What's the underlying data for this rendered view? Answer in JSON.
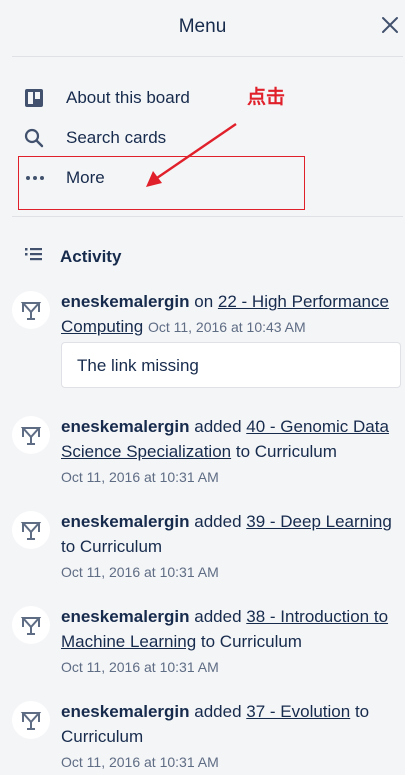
{
  "header": {
    "title": "Menu",
    "close_icon": "close-icon"
  },
  "menu": {
    "items": [
      {
        "label": "About this board",
        "icon": "board-icon"
      },
      {
        "label": "Search cards",
        "icon": "search-icon"
      },
      {
        "label": "More",
        "icon": "ellipsis-icon"
      }
    ]
  },
  "annotation": {
    "text": "点击",
    "color": "#e0202a"
  },
  "activity": {
    "heading": "Activity",
    "items": [
      {
        "user": "eneskemalergin",
        "verb": "on",
        "card": "22 - High Performance Computing",
        "suffix": "",
        "time": "Oct 11, 2016 at 10:43 AM",
        "comment": "The link missing"
      },
      {
        "user": "eneskemalergin",
        "verb": "added",
        "card": "40 - Genomic Data Science Specialization",
        "suffix": "to Curriculum",
        "time": "Oct 11, 2016 at 10:31 AM"
      },
      {
        "user": "eneskemalergin",
        "verb": "added",
        "card": "39 - Deep Learning",
        "suffix": "to Curriculum",
        "time": "Oct 11, 2016 at 10:31 AM"
      },
      {
        "user": "eneskemalergin",
        "verb": "added",
        "card": "38 - Introduction to Machine Learning",
        "suffix": "to Curriculum",
        "time": "Oct 11, 2016 at 10:31 AM"
      },
      {
        "user": "eneskemalergin",
        "verb": "added",
        "card": "37 - Evolution",
        "suffix": "to Curriculum",
        "time": "Oct 11, 2016 at 10:31 AM"
      }
    ]
  }
}
